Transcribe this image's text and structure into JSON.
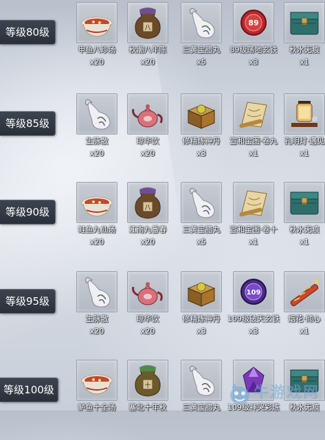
{
  "rows": [
    {
      "level": "等级80级",
      "items": [
        {
          "name": "甲鱼八珍汤",
          "count": "x20",
          "icon": "soup-bowl-icon"
        },
        {
          "name": "秋潮八年陈",
          "count": "x20",
          "icon": "wine-jar-icon"
        },
        {
          "name": "三黄宝腊丸",
          "count": "x5",
          "icon": "white-gourd-bottle-icon"
        },
        {
          "name": "89级荡地玄铁",
          "count": "x3",
          "icon": "red-iron-token-icon"
        },
        {
          "name": "秋水无痕",
          "count": "x1",
          "icon": "teal-chest-icon"
        }
      ]
    },
    {
      "level": "等级85级",
      "items": [
        {
          "name": "生脉散",
          "count": "x20",
          "icon": "white-gourd-bottle-icon"
        },
        {
          "name": "琼华饮",
          "count": "x20",
          "icon": "pink-teapot-icon"
        },
        {
          "name": "修精炼神丹",
          "count": "x3",
          "icon": "pill-box-icon"
        },
        {
          "name": "宣和宝图·卷九",
          "count": "x1",
          "icon": "treasure-map-icon"
        },
        {
          "name": "孔明灯·遇见",
          "count": "x1",
          "icon": "lantern-icon"
        }
      ]
    },
    {
      "level": "等级90级",
      "items": [
        {
          "name": "鲑鱼九仙汤",
          "count": "x20",
          "icon": "soup-bowl-icon"
        },
        {
          "name": "江南九番春",
          "count": "x20",
          "icon": "wine-jar-icon"
        },
        {
          "name": "三黄宝腊丸",
          "count": "x5",
          "icon": "white-gourd-bottle-icon"
        },
        {
          "name": "宣和宝图·卷十",
          "count": "x1",
          "icon": "treasure-map-icon"
        },
        {
          "name": "秋水无痕",
          "count": "x1",
          "icon": "teal-chest-icon"
        }
      ]
    },
    {
      "level": "等级95级",
      "items": [
        {
          "name": "生脉散",
          "count": "x20",
          "icon": "white-gourd-bottle-icon"
        },
        {
          "name": "琼华饮",
          "count": "x20",
          "icon": "pink-teapot-icon"
        },
        {
          "name": "修精炼神丹",
          "count": "x3",
          "icon": "pill-box-icon"
        },
        {
          "name": "109级破天玄铁",
          "count": "x3",
          "icon": "purple-iron-token-icon"
        },
        {
          "name": "烟花·倾心",
          "count": "x1",
          "icon": "firework-tube-icon"
        }
      ]
    },
    {
      "level": "等级100级",
      "items": [
        {
          "name": "鲈鱼十全汤",
          "count": "",
          "icon": "soup-bowl-icon"
        },
        {
          "name": "塞北十年秋",
          "count": "",
          "icon": "green-wine-jar-icon"
        },
        {
          "name": "三黄宝腊丸",
          "count": "",
          "icon": "white-gourd-bottle-icon"
        },
        {
          "name": "109级神哭彩炼",
          "count": "",
          "icon": "purple-gem-icon"
        },
        {
          "name": "秋水无痕",
          "count": "",
          "icon": "teal-chest-icon"
        }
      ]
    }
  ],
  "token_labels": {
    "red": "89",
    "purple": "109"
  },
  "colors": {
    "label_bg": "#2f3540",
    "text": "#ffffff"
  },
  "watermark": {
    "text": "牛游戏网"
  }
}
